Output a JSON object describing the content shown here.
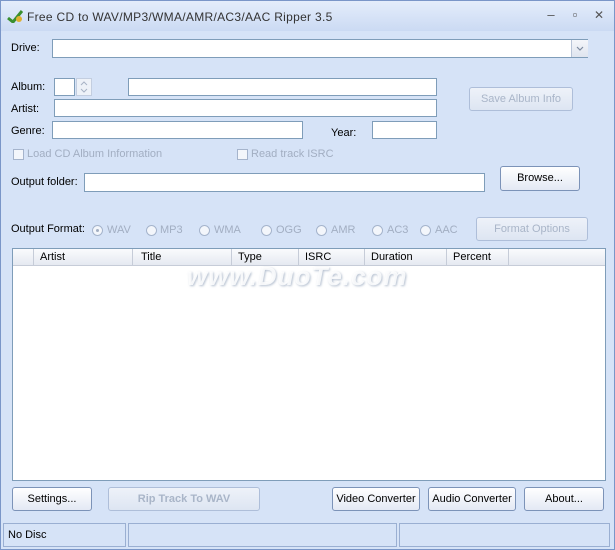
{
  "window": {
    "title": "Free CD to WAV/MP3/WMA/AMR/AC3/AAC Ripper 3.5",
    "minimize_glyph": "–",
    "maximize_glyph": "▫",
    "close_glyph": "✕"
  },
  "drive": {
    "label": "Drive:",
    "value": ""
  },
  "album": {
    "label": "Album:",
    "number": "",
    "value": ""
  },
  "artist": {
    "label": "Artist:",
    "value": ""
  },
  "genre": {
    "label": "Genre:",
    "value": ""
  },
  "year": {
    "label": "Year:",
    "value": ""
  },
  "save_album_info": "Save Album Info",
  "load_cd_info": "Load CD Album Information",
  "read_track_isrc": "Read track ISRC",
  "output_folder": {
    "label": "Output folder:",
    "value": ""
  },
  "browse": "Browse...",
  "output_format": {
    "label": "Output Format:",
    "options": [
      "WAV",
      "MP3",
      "WMA",
      "OGG",
      "AMR",
      "AC3",
      "AAC"
    ],
    "selected": "WAV"
  },
  "format_options": "Format Options",
  "track_list": {
    "columns": [
      "Artist",
      "Title",
      "Type",
      "ISRC",
      "Duration",
      "Percent"
    ]
  },
  "buttons": {
    "settings": "Settings...",
    "rip": "Rip Track To WAV",
    "video_converter": "Video Converter",
    "audio_converter": "Audio Converter",
    "about": "About..."
  },
  "status": {
    "disc": "No Disc",
    "pane2": "",
    "pane3": ""
  },
  "watermark": "www.DuoTe.com"
}
